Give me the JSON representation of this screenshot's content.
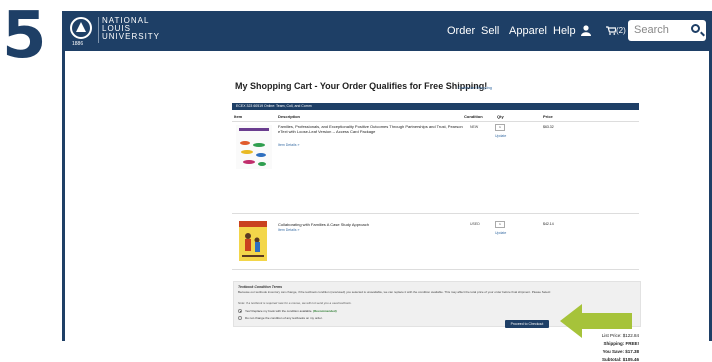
{
  "step_number": "5",
  "logo": {
    "year": "1886",
    "line1": "NATIONAL",
    "line2": "LOUIS",
    "line3": "UNIVERSITY"
  },
  "nav": {
    "order": "Order",
    "sell": "Sell",
    "apparel": "Apparel",
    "help": "Help",
    "cart_count": "(2)"
  },
  "search": {
    "placeholder": "Search"
  },
  "page": {
    "title": "My Shopping Cart - Your Order Qualifies for Free Shipping!",
    "continue_link": "Continue Shopping",
    "course": "ECEX 323 60519 Online: Team, Coll, and Comm",
    "columns": {
      "item": "Item",
      "description": "Description",
      "condition": "Condition",
      "qty": "Qty",
      "price": "Price"
    }
  },
  "items": [
    {
      "title": "Families, Professionals, and Exceptionality Positive Outcomes Through Partnerships and Trust, Pearson eText with Loose-Leaf Version -- Access Card Package",
      "details": "Item Details »",
      "condition": "NEW",
      "qty": "1",
      "update": "Update",
      "price": "$63.32"
    },
    {
      "title": "Collaborating with Families A Case Study Approach",
      "details": "Item Details »",
      "condition": "USED",
      "qty": "1",
      "update": "Update",
      "price": "$42.14"
    }
  ],
  "terms": {
    "heading": "Textbook Condition Terms",
    "text": "Because our textbook inventory can change, if the textbook condition (new/used) you selected is unavailable, we can replace it with the condition available. This may affect the total price of your order before final shipment. Please Select:",
    "note": "Note: If a textbook is required new for a course, we will not send you a used textbook.",
    "option1": "Yes! Replace my book with the condition available.",
    "option1_tag": "(Recommended)",
    "option2": "Do not change the condition of any textbooks on my order."
  },
  "summary": {
    "list_price": "List Price: $122.84",
    "shipping": "Shipping: FREE!",
    "you_save": "You Save: $17.38",
    "subtotal": "Subtotal: $105.46"
  },
  "checkout_label": "Proceed to Checkout",
  "colors": {
    "brand": "#1e3f66",
    "arrow": "#a6c33a",
    "link": "#3a6ea5"
  }
}
